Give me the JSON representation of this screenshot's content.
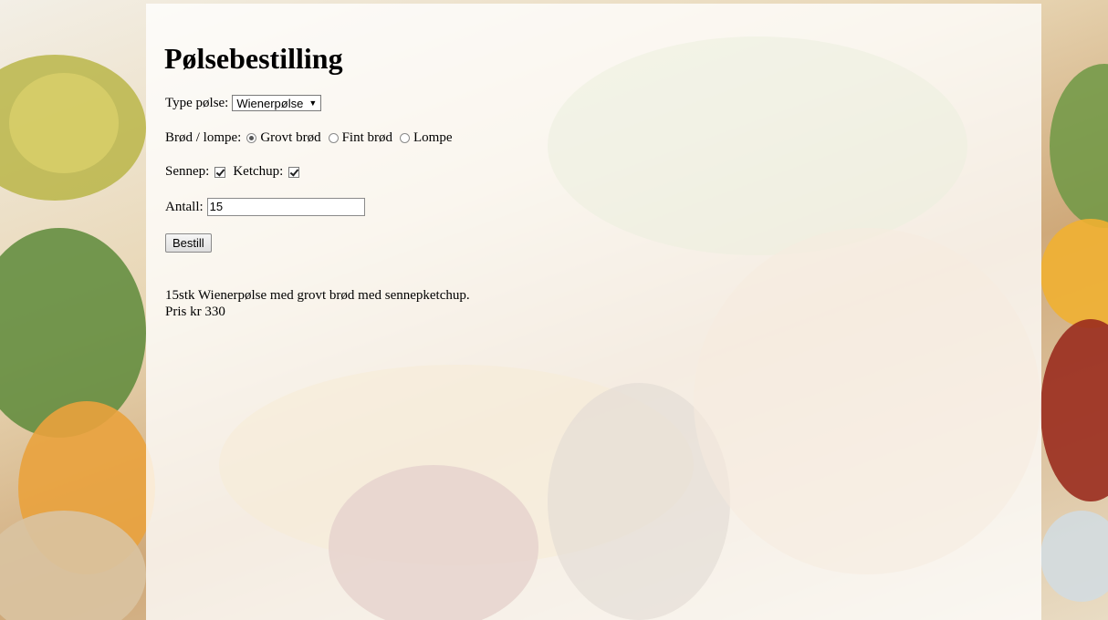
{
  "page": {
    "title": "Pølsebestilling"
  },
  "form": {
    "type_label": "Type pølse:",
    "type_selected": "Wienerpølse",
    "bread_label": "Brød / lompe:",
    "bread_options": [
      {
        "label": "Grovt brød",
        "checked": true
      },
      {
        "label": "Fint brød",
        "checked": false
      },
      {
        "label": "Lompe",
        "checked": false
      }
    ],
    "mustard_label": "Sennep:",
    "mustard_checked": true,
    "ketchup_label": "Ketchup:",
    "ketchup_checked": true,
    "quantity_label": "Antall:",
    "quantity_value": "15",
    "submit_label": "Bestill"
  },
  "result": {
    "line1": "15stk Wienerpølse med grovt brød med sennepketchup.",
    "line2": "Pris kr 330"
  },
  "colors": {
    "panel_overlay": "#ffffffc7"
  },
  "icons": {
    "select_caret": "caret-down-icon"
  }
}
